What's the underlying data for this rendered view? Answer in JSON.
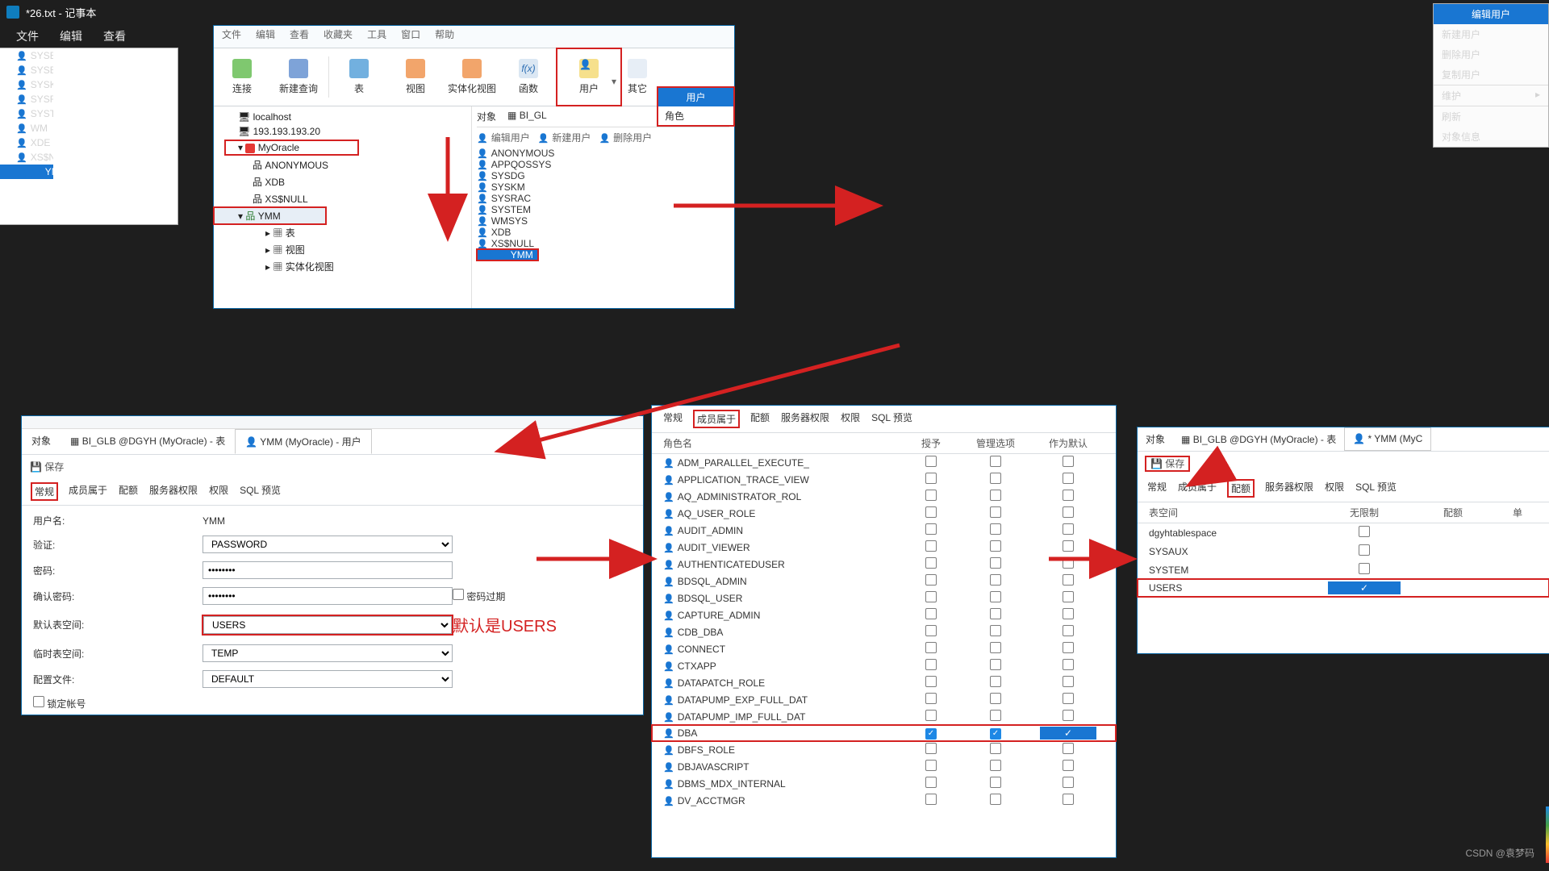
{
  "outer": {
    "title": "*26.txt - 记事本",
    "menus": [
      "文件",
      "编辑",
      "查看"
    ]
  },
  "panelA": {
    "topmenu": [
      "文件",
      "编辑",
      "查看",
      "收藏夹",
      "工具",
      "窗口",
      "帮助"
    ],
    "ribbon": {
      "connect": "连接",
      "newquery": "新建查询",
      "table": "表",
      "view": "视图",
      "matview": "实体化视图",
      "func": "函数",
      "user": "用户",
      "other": "其它"
    },
    "dropdown": {
      "user": "用户",
      "role": "角色"
    },
    "tree": {
      "localhost": "localhost",
      "ip": "193.193.193.20",
      "myoracle": "MyOracle",
      "anonymous": "ANONYMOUS",
      "xdb": "XDB",
      "xsnull": "XS$NULL",
      "ymm": "YMM",
      "table": "表",
      "view": "视图",
      "matview": "实体化视图"
    },
    "right": {
      "objtab": "对象",
      "tabletab": "BI_GL",
      "editUser": "编辑用户",
      "newUser": "新建用户",
      "delUser": "删除用户",
      "users": [
        "ANONYMOUS",
        "APPQOSSYS",
        "SYSDG",
        "SYSKM",
        "SYSRAC",
        "SYSTEM",
        "WMSYS",
        "XDB",
        "XS$NULL",
        "YMM"
      ]
    }
  },
  "panelB": {
    "users": [
      "SYSE",
      "SYSE",
      "SYSK",
      "SYSF",
      "SYST",
      "WM",
      "XDE",
      "XS$N",
      "YMM"
    ],
    "menu": [
      "编辑用户",
      "新建用户",
      "删除用户",
      "复制用户",
      "维护",
      "刷新",
      "对象信息"
    ]
  },
  "panelC": {
    "tabs": {
      "obj": "对象",
      "tbl": "BI_GLB @DGYH (MyOracle) - 表",
      "usr": "YMM (MyOracle) - 用户"
    },
    "save": "保存",
    "subtabs": [
      "常规",
      "成员属于",
      "配额",
      "服务器权限",
      "权限",
      "SQL 预览"
    ],
    "labels": {
      "username": "用户名:",
      "auth": "验证:",
      "pwd": "密码:",
      "confirm": "确认密码:",
      "defts": "默认表空间:",
      "tmpts": "临时表空间:",
      "profile": "配置文件:",
      "lock": "锁定帐号",
      "expire": "密码过期"
    },
    "values": {
      "username": "YMM",
      "auth": "PASSWORD",
      "pwd": "••••••••",
      "confirm": "••••••••",
      "defts": "USERS",
      "tmpts": "TEMP",
      "profile": "DEFAULT"
    },
    "note": "默认是USERS"
  },
  "panelD": {
    "subtabs": [
      "常规",
      "成员属于",
      "配额",
      "服务器权限",
      "权限",
      "SQL 预览"
    ],
    "cols": {
      "role": "角色名",
      "grant": "授予",
      "admin": "管理选项",
      "default": "作为默认"
    },
    "roles": [
      "ADM_PARALLEL_EXECUTE_",
      "APPLICATION_TRACE_VIEW",
      "AQ_ADMINISTRATOR_ROL",
      "AQ_USER_ROLE",
      "AUDIT_ADMIN",
      "AUDIT_VIEWER",
      "AUTHENTICATEDUSER",
      "BDSQL_ADMIN",
      "BDSQL_USER",
      "CAPTURE_ADMIN",
      "CDB_DBA",
      "CONNECT",
      "CTXAPP",
      "DATAPATCH_ROLE",
      "DATAPUMP_EXP_FULL_DAT",
      "DATAPUMP_IMP_FULL_DAT",
      "DBA",
      "DBFS_ROLE",
      "DBJAVASCRIPT",
      "DBMS_MDX_INTERNAL",
      "DV_ACCTMGR"
    ]
  },
  "panelE": {
    "tabs": {
      "obj": "对象",
      "tbl": "BI_GLB @DGYH (MyOracle) - 表",
      "usr": "* YMM (MyC"
    },
    "save": "保存",
    "subtabs": [
      "常规",
      "成员属于",
      "配额",
      "服务器权限",
      "权限",
      "SQL 预览"
    ],
    "cols": {
      "ts": "表空间",
      "unlimited": "无限制",
      "quota": "配额",
      "unit": "单"
    },
    "rows": [
      "dgyhtablespace",
      "SYSAUX",
      "SYSTEM",
      "USERS"
    ]
  },
  "watermark": "CSDN @袁梦码"
}
